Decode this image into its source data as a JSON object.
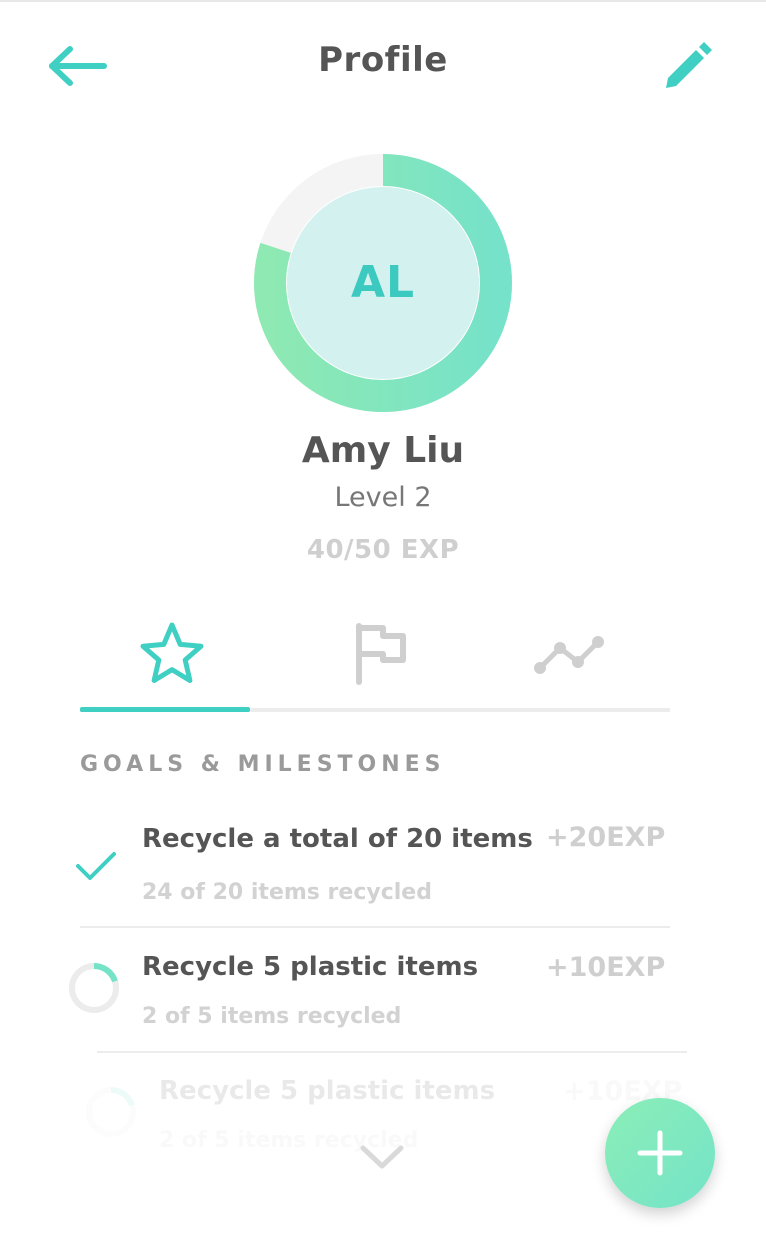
{
  "header": {
    "title": "Profile",
    "back_icon": "arrow-left-icon",
    "edit_icon": "pencil-icon"
  },
  "profile": {
    "initials": "AL",
    "name": "Amy Liu",
    "level": "Level 2",
    "exp": "40/50 EXP",
    "exp_progress": 0.8
  },
  "tabs": [
    {
      "icon": "star-icon",
      "active": true
    },
    {
      "icon": "flag-icon",
      "active": false
    },
    {
      "icon": "trend-line-icon",
      "active": false
    }
  ],
  "goals": {
    "section_title": "GOALS & MILESTONES",
    "items": [
      {
        "title": "Recycle a total of 20 items",
        "subtitle": "24 of 20 items recycled",
        "reward": "+20EXP",
        "status": "complete",
        "progress": 1.0
      },
      {
        "title": "Recycle 5 plastic items",
        "subtitle": "2 of 5 items recycled",
        "reward": "+10EXP",
        "status": "in-progress",
        "progress": 0.2
      },
      {
        "title": "Recycle 5 plastic items",
        "subtitle": "2 of 5 items recycled",
        "reward": "+10EXP",
        "status": "in-progress",
        "progress": 0.2
      }
    ]
  },
  "colors": {
    "accent": "#3fcfc3",
    "ring_start": "#8ee9b2",
    "ring_end": "#76e2c9",
    "avatar_fill": "#d3f1ef",
    "muted": "#cfcfcf"
  },
  "scroll_hint_icon": "chevron-down-icon",
  "fab_icon": "plus-icon"
}
